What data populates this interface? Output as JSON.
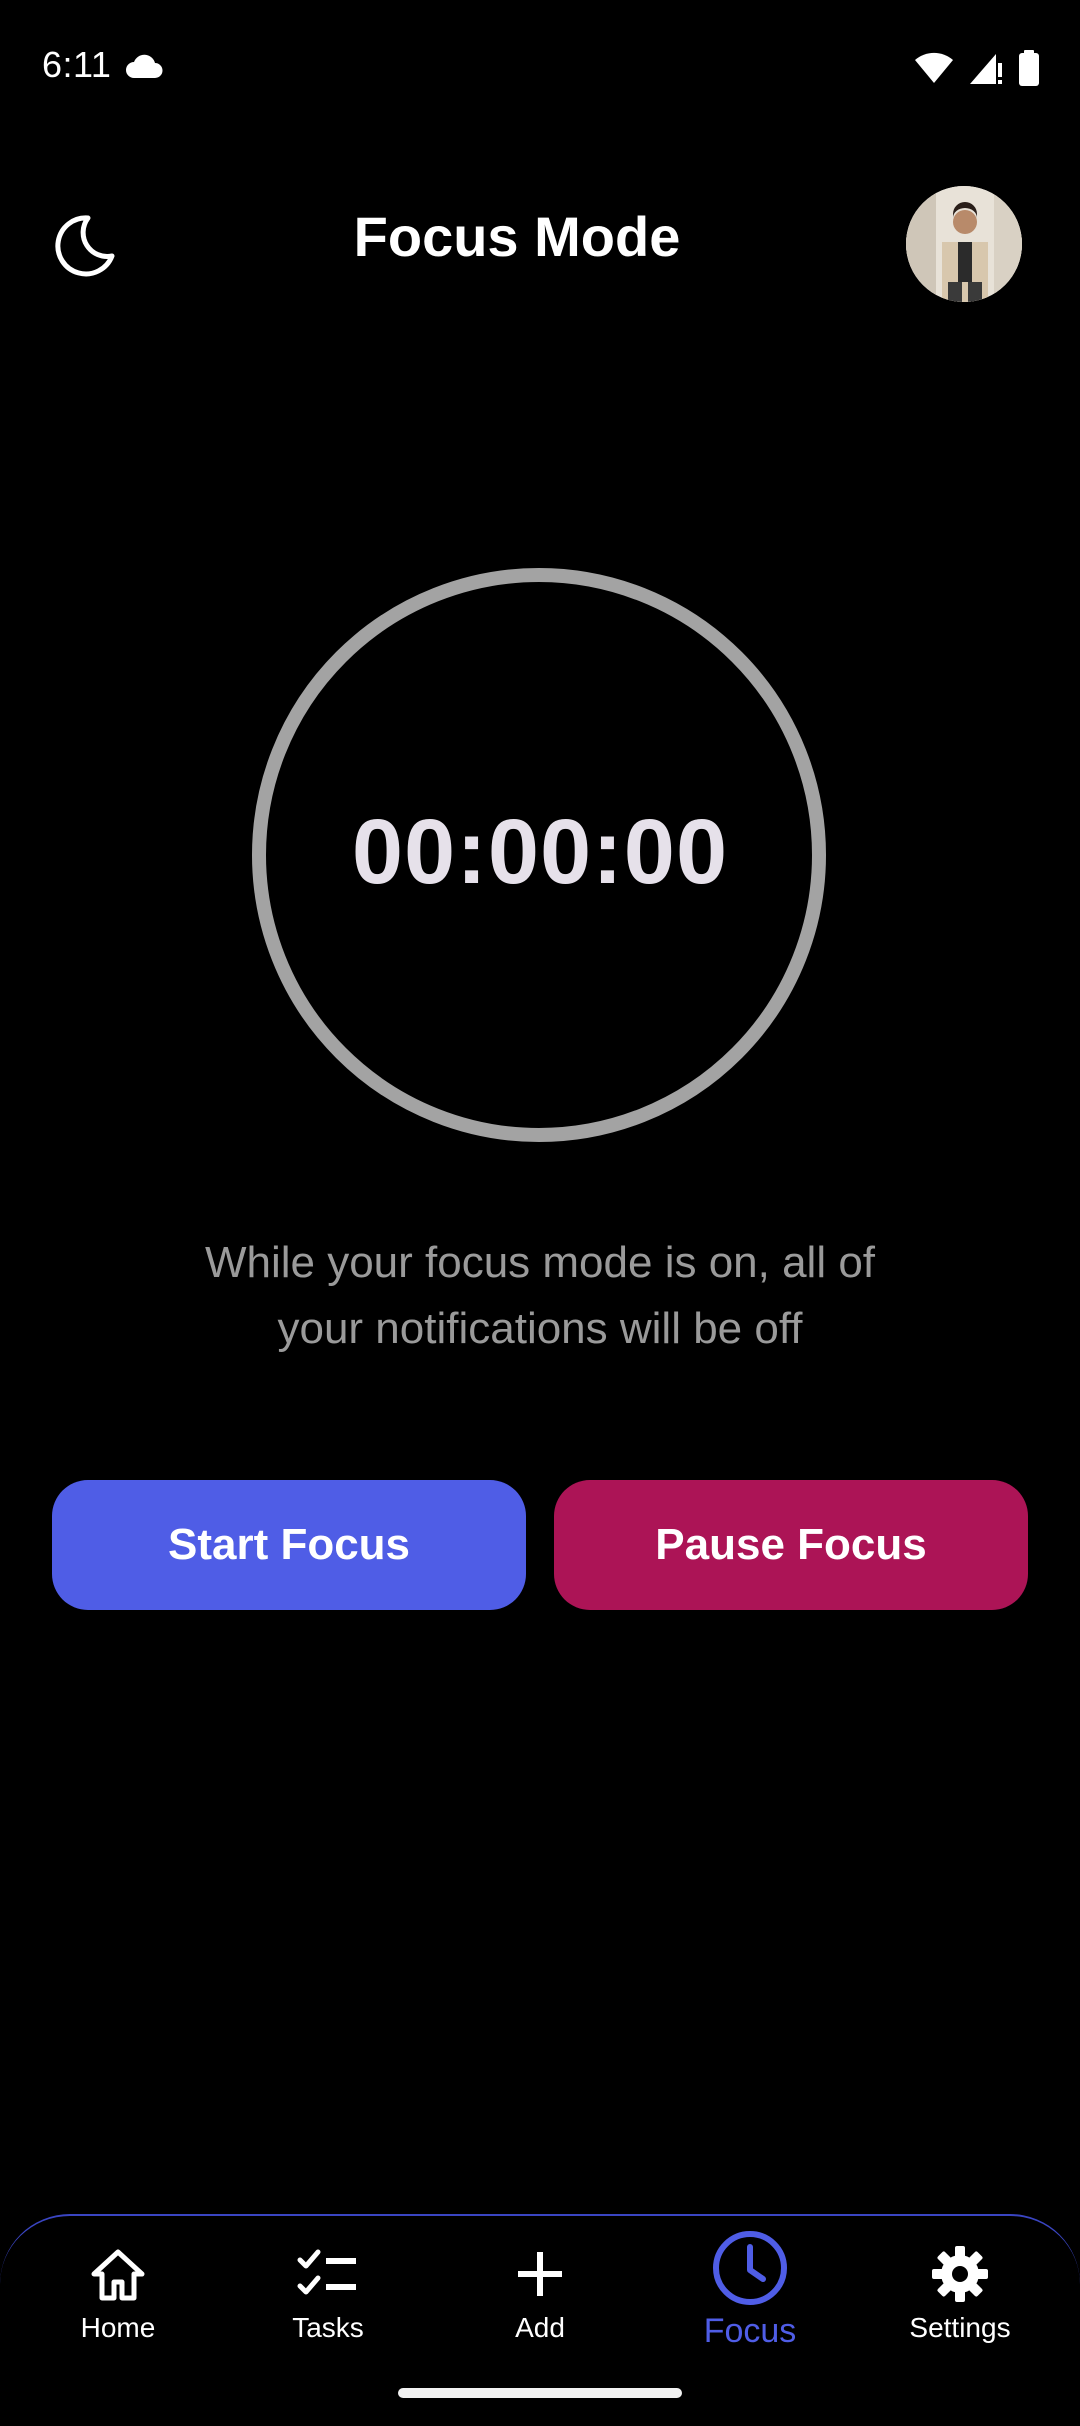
{
  "status_bar": {
    "time": "6:11",
    "icons": [
      "cloud-icon",
      "wifi-icon",
      "signal-icon",
      "battery-icon"
    ]
  },
  "header": {
    "title": "Focus Mode",
    "theme_icon": "moon-icon",
    "avatar": "profile-avatar"
  },
  "timer": {
    "display": "00:00:00",
    "ring_color": "#a3a3a3"
  },
  "info": {
    "line1": "While your focus mode is on, all of",
    "line2": "your notifications will be off"
  },
  "buttons": {
    "start_label": "Start Focus",
    "pause_label": "Pause Focus",
    "start_color": "#4f5de6",
    "pause_color": "#ac1456"
  },
  "bottom_nav": {
    "items": [
      {
        "label": "Home",
        "icon": "home-icon"
      },
      {
        "label": "Tasks",
        "icon": "tasks-icon"
      },
      {
        "label": "Add",
        "icon": "plus-icon"
      },
      {
        "label": "Focus",
        "icon": "clock-icon",
        "active": true
      },
      {
        "label": "Settings",
        "icon": "gear-icon"
      }
    ],
    "active_color": "#4f5de6"
  }
}
